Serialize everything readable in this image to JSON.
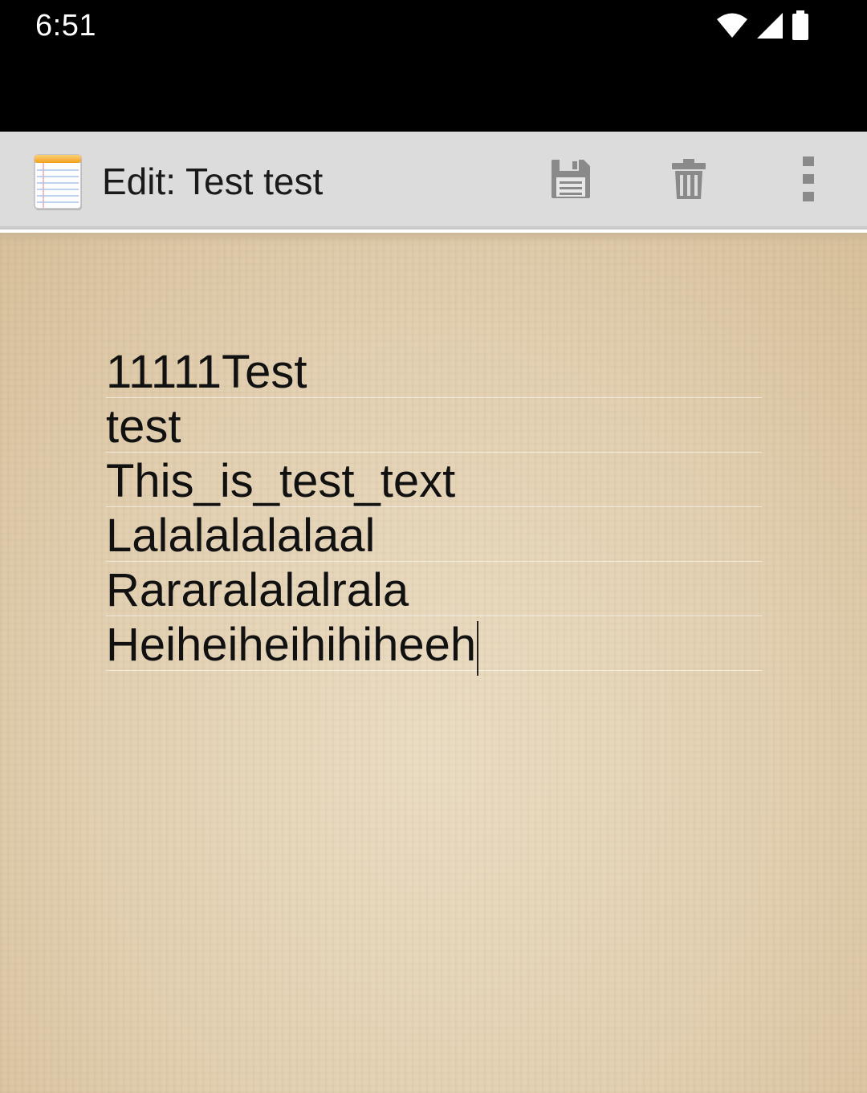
{
  "status_bar": {
    "time": "6:51",
    "icons": [
      "wifi-icon",
      "cell-signal-icon",
      "battery-icon"
    ]
  },
  "action_bar": {
    "app_icon": "notepad-icon",
    "title": "Edit: Test test",
    "actions": [
      "save-icon",
      "trash-icon",
      "overflow-menu-icon"
    ]
  },
  "note": {
    "lines": [
      "11111Test",
      "test",
      "This_is_test_text",
      "Lalalalalalaal",
      "Rararalalalrala",
      "Heiheiheihihiheeh"
    ]
  },
  "colors": {
    "status_bar_bg": "#000000",
    "action_bar_bg": "#dcdcdc",
    "paper": "#e2cfb0",
    "text": "#111111"
  }
}
